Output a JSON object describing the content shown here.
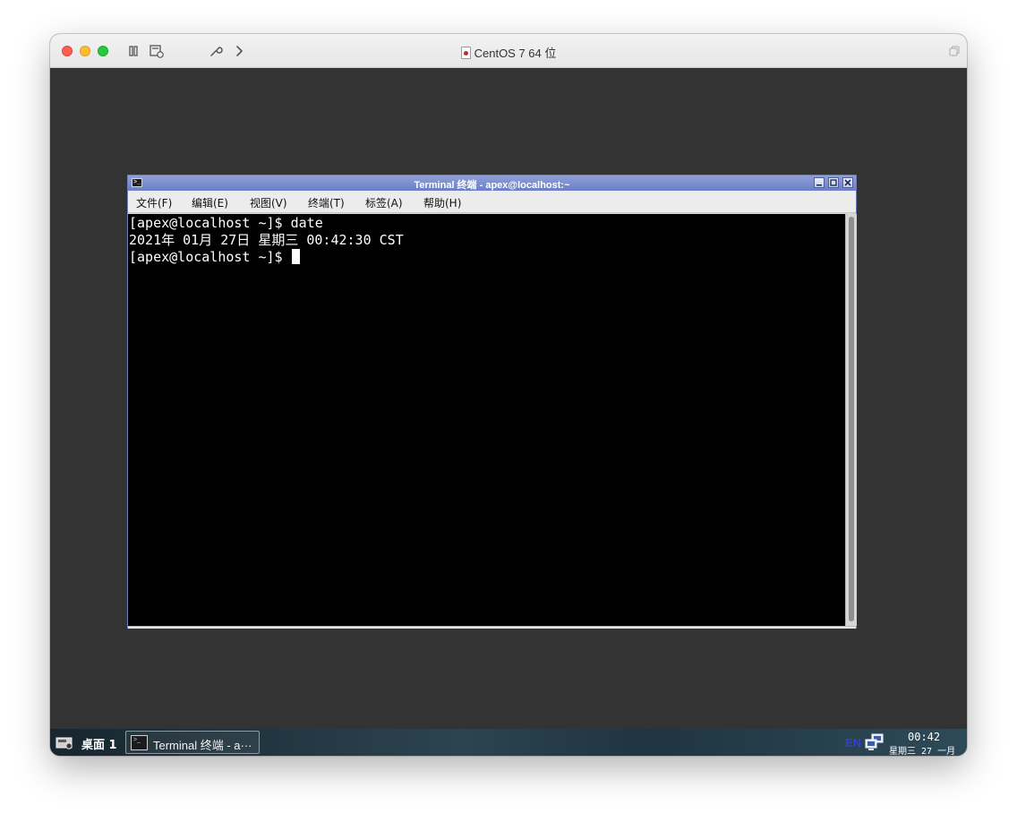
{
  "host": {
    "title": "CentOS 7 64 位"
  },
  "terminal": {
    "title": "Terminal 终端 - apex@localhost:~",
    "menu": [
      "文件(F)",
      "编辑(E)",
      "视图(V)",
      "终端(T)",
      "标签(A)",
      "帮助(H)"
    ],
    "lines": [
      "[apex@localhost ~]$ date",
      "2021年 01月 27日 星期三 00:42:30 CST",
      "[apex@localhost ~]$ "
    ]
  },
  "taskbar": {
    "desktop_label": "桌面 1",
    "task_label": "Terminal 终端 - a···",
    "language": "EN",
    "clock_time": "00:42",
    "clock_date": "星期三 27 一月"
  },
  "colors": {
    "terminal_bg": "#000000",
    "terminal_fg": "#ffffff",
    "titlebar_accent": "#6a7fc6",
    "language_indicator": "#3b3bd6"
  },
  "icons": [
    "pause-icon",
    "snapshot-icon",
    "wrench-icon",
    "chevron-right-icon",
    "document-icon",
    "restore-window-icon",
    "terminal-app-icon",
    "minimize-icon",
    "maximize-icon",
    "close-icon",
    "start-menu-icon",
    "network-icon"
  ]
}
